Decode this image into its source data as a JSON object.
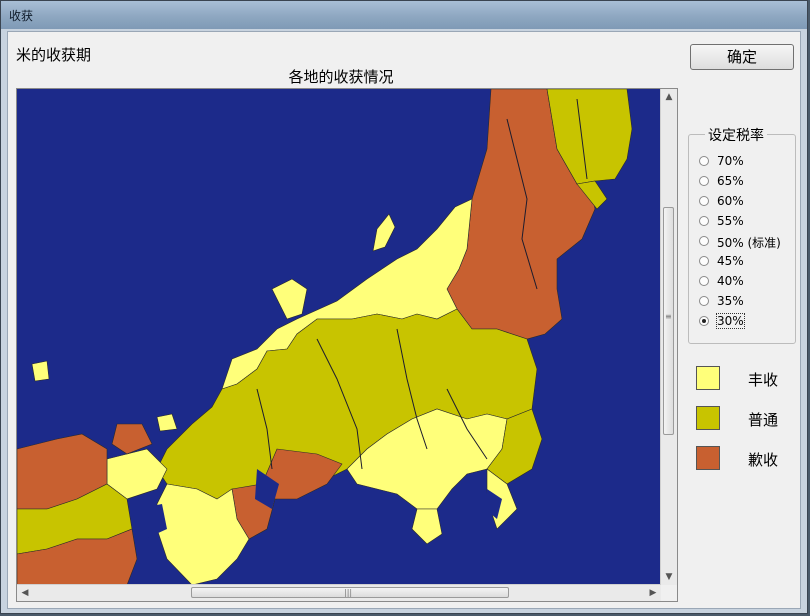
{
  "window": {
    "title": "收获"
  },
  "dialog": {
    "subtitle": "米的收获期",
    "map_title": "各地的收获情况",
    "ok_label": "确定"
  },
  "tax": {
    "legend": "设定税率",
    "options": [
      "70%",
      "65%",
      "60%",
      "55%",
      "50% (标准)",
      "45%",
      "40%",
      "35%",
      "30%"
    ],
    "selected": "30%"
  },
  "legend_items": [
    {
      "label": "丰收",
      "color": "#ffff7a"
    },
    {
      "label": "普通",
      "color": "#c8c400"
    },
    {
      "label": "歉收",
      "color": "#c86030"
    }
  ],
  "colors": {
    "sea": "#1c2a8a",
    "good": "#ffff7a",
    "normal": "#c8c400",
    "poor": "#c86030",
    "border": "#2a2a2a"
  },
  "scroll": {
    "vertical_grip": "≡",
    "horizontal_grip": "|||"
  }
}
